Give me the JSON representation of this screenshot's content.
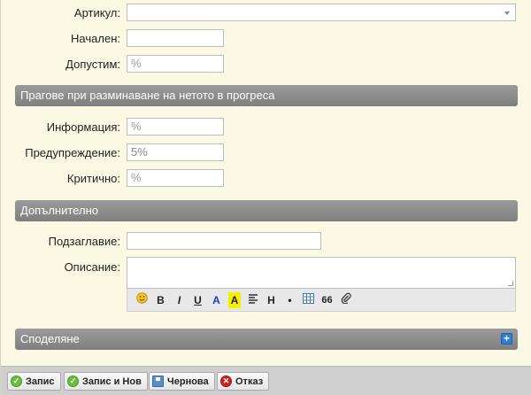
{
  "fields": {
    "article": {
      "label": "Артикул:",
      "value": ""
    },
    "initial": {
      "label": "Начален:",
      "value": ""
    },
    "allowed": {
      "label": "Допустим:",
      "placeholder": "%"
    }
  },
  "thresholds": {
    "section_title": "Прагове при разминаване на нетото в прогреса",
    "info": {
      "label": "Информация:",
      "placeholder": "%"
    },
    "warning": {
      "label": "Предупреждение:",
      "value": "5%"
    },
    "critical": {
      "label": "Критично:",
      "placeholder": "%"
    }
  },
  "additional": {
    "section_title": "Допълнително",
    "subtitle": {
      "label": "Подзаглавие:",
      "value": ""
    },
    "description": {
      "label": "Описание:",
      "value": ""
    },
    "editor_toolbar": {
      "bold": "B",
      "italic": "I",
      "underline": "U",
      "font_color": "A",
      "highlight": "A",
      "heading": "H",
      "bullet": "•",
      "quote": "66"
    }
  },
  "sharing": {
    "section_title": "Споделяне",
    "expand_glyph": "+"
  },
  "buttons": {
    "save": "Запис",
    "save_new": "Запис и Нов",
    "draft": "Чернова",
    "cancel": "Отказ"
  },
  "colors": {
    "background": "#fbf9e3",
    "section_header": "#8c8c8c",
    "expand_icon": "#2f7ed8",
    "ok_icon": "#6cbf3c",
    "cancel_icon": "#cc2222"
  }
}
